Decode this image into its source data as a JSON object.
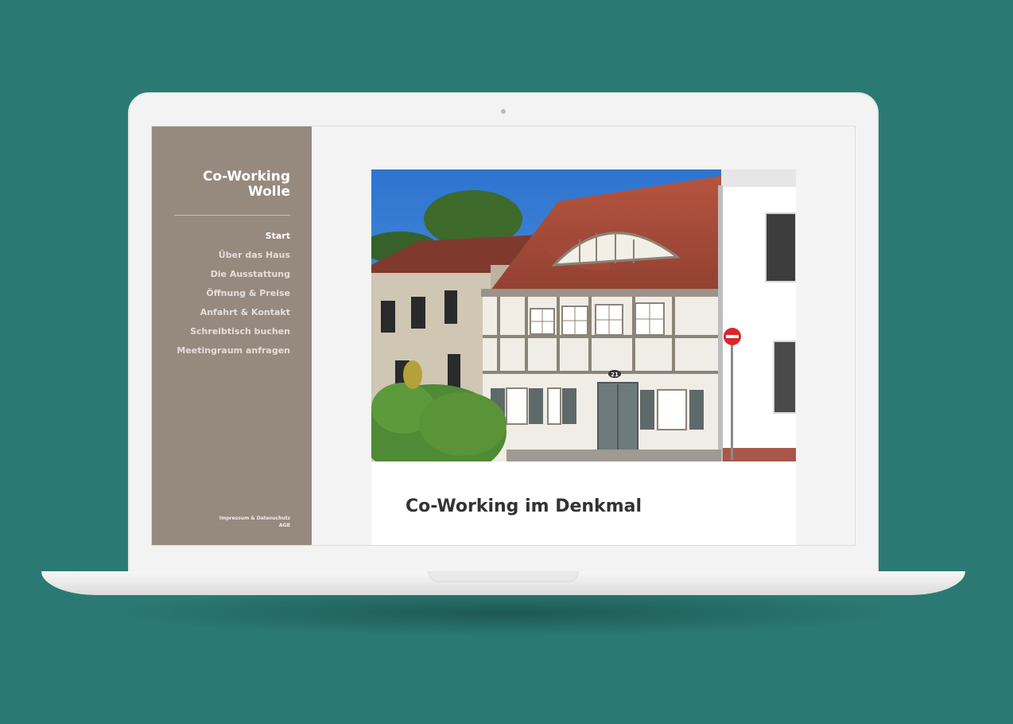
{
  "sidebar": {
    "brand_line1": "Co-Working",
    "brand_line2": "Wolle",
    "items": [
      {
        "label": "Start",
        "active": true
      },
      {
        "label": "Über das Haus",
        "active": false
      },
      {
        "label": "Die Ausstattung",
        "active": false
      },
      {
        "label": "Öffnung & Preise",
        "active": false
      },
      {
        "label": "Anfahrt & Kontakt",
        "active": false
      },
      {
        "label": "Schreibtisch buchen",
        "active": false
      },
      {
        "label": "Meetingraum anfragen",
        "active": false
      }
    ],
    "footer_line1": "Impressum & Datenschutz",
    "footer_line2": "AGB"
  },
  "main": {
    "hero_house_number": "21",
    "title": "Co-Working im Denkmal"
  },
  "colors": {
    "background": "#2a7a73",
    "sidebar": "#968a7e",
    "title_text": "#333333"
  }
}
